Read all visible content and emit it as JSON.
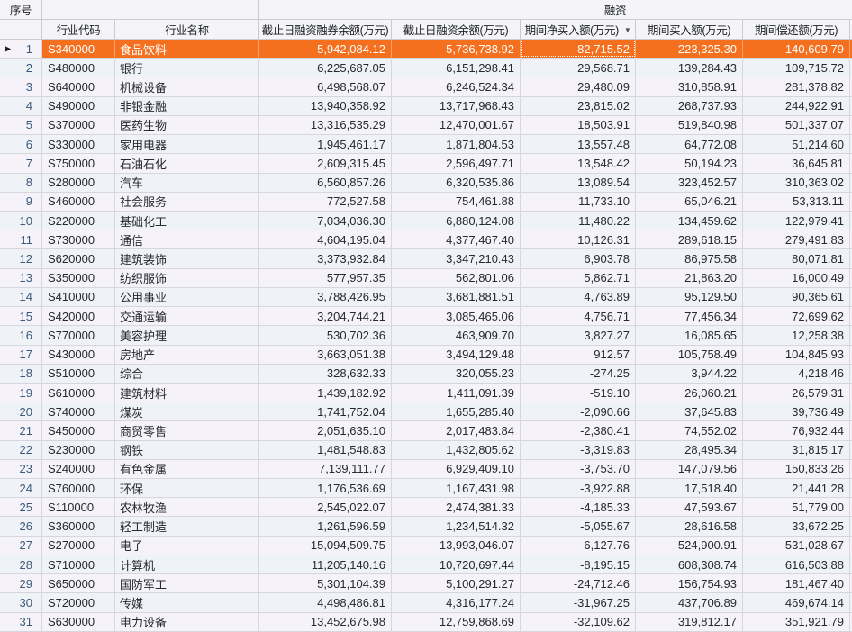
{
  "table": {
    "seq_header": "序号",
    "group_header": "融资",
    "columns": [
      "行业代码",
      "行业名称",
      "截止日融资融券余额(万元)",
      "截止日融资余额(万元)",
      "期间净买入额(万元)",
      "期间买入额(万元)",
      "期间偿还额(万元)"
    ],
    "sorted_column": "期间净买入额(万元)",
    "sort_direction": "desc",
    "sort_icon": "▼",
    "current_row_arrow": "▶",
    "selected_index": 0,
    "focused_value_index": 2,
    "colors": {
      "selected_bg": "#f4701f",
      "selected_text": "#ffffff",
      "row_odd": "#f5f2fa",
      "row_even": "#eff2f6"
    },
    "rows": [
      {
        "num": "1",
        "code": "S340000",
        "name": "食品饮料",
        "values": [
          "5,942,084.12",
          "5,736,738.92",
          "82,715.52",
          "223,325.30",
          "140,609.79"
        ]
      },
      {
        "num": "2",
        "code": "S480000",
        "name": "银行",
        "values": [
          "6,225,687.05",
          "6,151,298.41",
          "29,568.71",
          "139,284.43",
          "109,715.72"
        ]
      },
      {
        "num": "3",
        "code": "S640000",
        "name": "机械设备",
        "values": [
          "6,498,568.07",
          "6,246,524.34",
          "29,480.09",
          "310,858.91",
          "281,378.82"
        ]
      },
      {
        "num": "4",
        "code": "S490000",
        "name": "非银金融",
        "values": [
          "13,940,358.92",
          "13,717,968.43",
          "23,815.02",
          "268,737.93",
          "244,922.91"
        ]
      },
      {
        "num": "5",
        "code": "S370000",
        "name": "医药生物",
        "values": [
          "13,316,535.29",
          "12,470,001.67",
          "18,503.91",
          "519,840.98",
          "501,337.07"
        ]
      },
      {
        "num": "6",
        "code": "S330000",
        "name": "家用电器",
        "values": [
          "1,945,461.17",
          "1,871,804.53",
          "13,557.48",
          "64,772.08",
          "51,214.60"
        ]
      },
      {
        "num": "7",
        "code": "S750000",
        "name": "石油石化",
        "values": [
          "2,609,315.45",
          "2,596,497.71",
          "13,548.42",
          "50,194.23",
          "36,645.81"
        ]
      },
      {
        "num": "8",
        "code": "S280000",
        "name": "汽车",
        "values": [
          "6,560,857.26",
          "6,320,535.86",
          "13,089.54",
          "323,452.57",
          "310,363.02"
        ]
      },
      {
        "num": "9",
        "code": "S460000",
        "name": "社会服务",
        "values": [
          "772,527.58",
          "754,461.88",
          "11,733.10",
          "65,046.21",
          "53,313.11"
        ]
      },
      {
        "num": "10",
        "code": "S220000",
        "name": "基础化工",
        "values": [
          "7,034,036.30",
          "6,880,124.08",
          "11,480.22",
          "134,459.62",
          "122,979.41"
        ]
      },
      {
        "num": "11",
        "code": "S730000",
        "name": "通信",
        "values": [
          "4,604,195.04",
          "4,377,467.40",
          "10,126.31",
          "289,618.15",
          "279,491.83"
        ]
      },
      {
        "num": "12",
        "code": "S620000",
        "name": "建筑装饰",
        "values": [
          "3,373,932.84",
          "3,347,210.43",
          "6,903.78",
          "86,975.58",
          "80,071.81"
        ]
      },
      {
        "num": "13",
        "code": "S350000",
        "name": "纺织服饰",
        "values": [
          "577,957.35",
          "562,801.06",
          "5,862.71",
          "21,863.20",
          "16,000.49"
        ]
      },
      {
        "num": "14",
        "code": "S410000",
        "name": "公用事业",
        "values": [
          "3,788,426.95",
          "3,681,881.51",
          "4,763.89",
          "95,129.50",
          "90,365.61"
        ]
      },
      {
        "num": "15",
        "code": "S420000",
        "name": "交通运输",
        "values": [
          "3,204,744.21",
          "3,085,465.06",
          "4,756.71",
          "77,456.34",
          "72,699.62"
        ]
      },
      {
        "num": "16",
        "code": "S770000",
        "name": "美容护理",
        "values": [
          "530,702.36",
          "463,909.70",
          "3,827.27",
          "16,085.65",
          "12,258.38"
        ]
      },
      {
        "num": "17",
        "code": "S430000",
        "name": "房地产",
        "values": [
          "3,663,051.38",
          "3,494,129.48",
          "912.57",
          "105,758.49",
          "104,845.93"
        ]
      },
      {
        "num": "18",
        "code": "S510000",
        "name": "综合",
        "values": [
          "328,632.33",
          "320,055.23",
          "-274.25",
          "3,944.22",
          "4,218.46"
        ]
      },
      {
        "num": "19",
        "code": "S610000",
        "name": "建筑材料",
        "values": [
          "1,439,182.92",
          "1,411,091.39",
          "-519.10",
          "26,060.21",
          "26,579.31"
        ]
      },
      {
        "num": "20",
        "code": "S740000",
        "name": "煤炭",
        "values": [
          "1,741,752.04",
          "1,655,285.40",
          "-2,090.66",
          "37,645.83",
          "39,736.49"
        ]
      },
      {
        "num": "21",
        "code": "S450000",
        "name": "商贸零售",
        "values": [
          "2,051,635.10",
          "2,017,483.84",
          "-2,380.41",
          "74,552.02",
          "76,932.44"
        ]
      },
      {
        "num": "22",
        "code": "S230000",
        "name": "钢铁",
        "values": [
          "1,481,548.83",
          "1,432,805.62",
          "-3,319.83",
          "28,495.34",
          "31,815.17"
        ]
      },
      {
        "num": "23",
        "code": "S240000",
        "name": "有色金属",
        "values": [
          "7,139,111.77",
          "6,929,409.10",
          "-3,753.70",
          "147,079.56",
          "150,833.26"
        ]
      },
      {
        "num": "24",
        "code": "S760000",
        "name": "环保",
        "values": [
          "1,176,536.69",
          "1,167,431.98",
          "-3,922.88",
          "17,518.40",
          "21,441.28"
        ]
      },
      {
        "num": "25",
        "code": "S110000",
        "name": "农林牧渔",
        "values": [
          "2,545,022.07",
          "2,474,381.33",
          "-4,185.33",
          "47,593.67",
          "51,779.00"
        ]
      },
      {
        "num": "26",
        "code": "S360000",
        "name": "轻工制造",
        "values": [
          "1,261,596.59",
          "1,234,514.32",
          "-5,055.67",
          "28,616.58",
          "33,672.25"
        ]
      },
      {
        "num": "27",
        "code": "S270000",
        "name": "电子",
        "values": [
          "15,094,509.75",
          "13,993,046.07",
          "-6,127.76",
          "524,900.91",
          "531,028.67"
        ]
      },
      {
        "num": "28",
        "code": "S710000",
        "name": "计算机",
        "values": [
          "11,205,140.16",
          "10,720,697.44",
          "-8,195.15",
          "608,308.74",
          "616,503.88"
        ]
      },
      {
        "num": "29",
        "code": "S650000",
        "name": "国防军工",
        "values": [
          "5,301,104.39",
          "5,100,291.27",
          "-24,712.46",
          "156,754.93",
          "181,467.40"
        ]
      },
      {
        "num": "30",
        "code": "S720000",
        "name": "传媒",
        "values": [
          "4,498,486.81",
          "4,316,177.24",
          "-31,967.25",
          "437,706.89",
          "469,674.14"
        ]
      },
      {
        "num": "31",
        "code": "S630000",
        "name": "电力设备",
        "values": [
          "13,452,675.98",
          "12,759,868.69",
          "-32,109.62",
          "319,812.17",
          "351,921.79"
        ]
      }
    ]
  }
}
